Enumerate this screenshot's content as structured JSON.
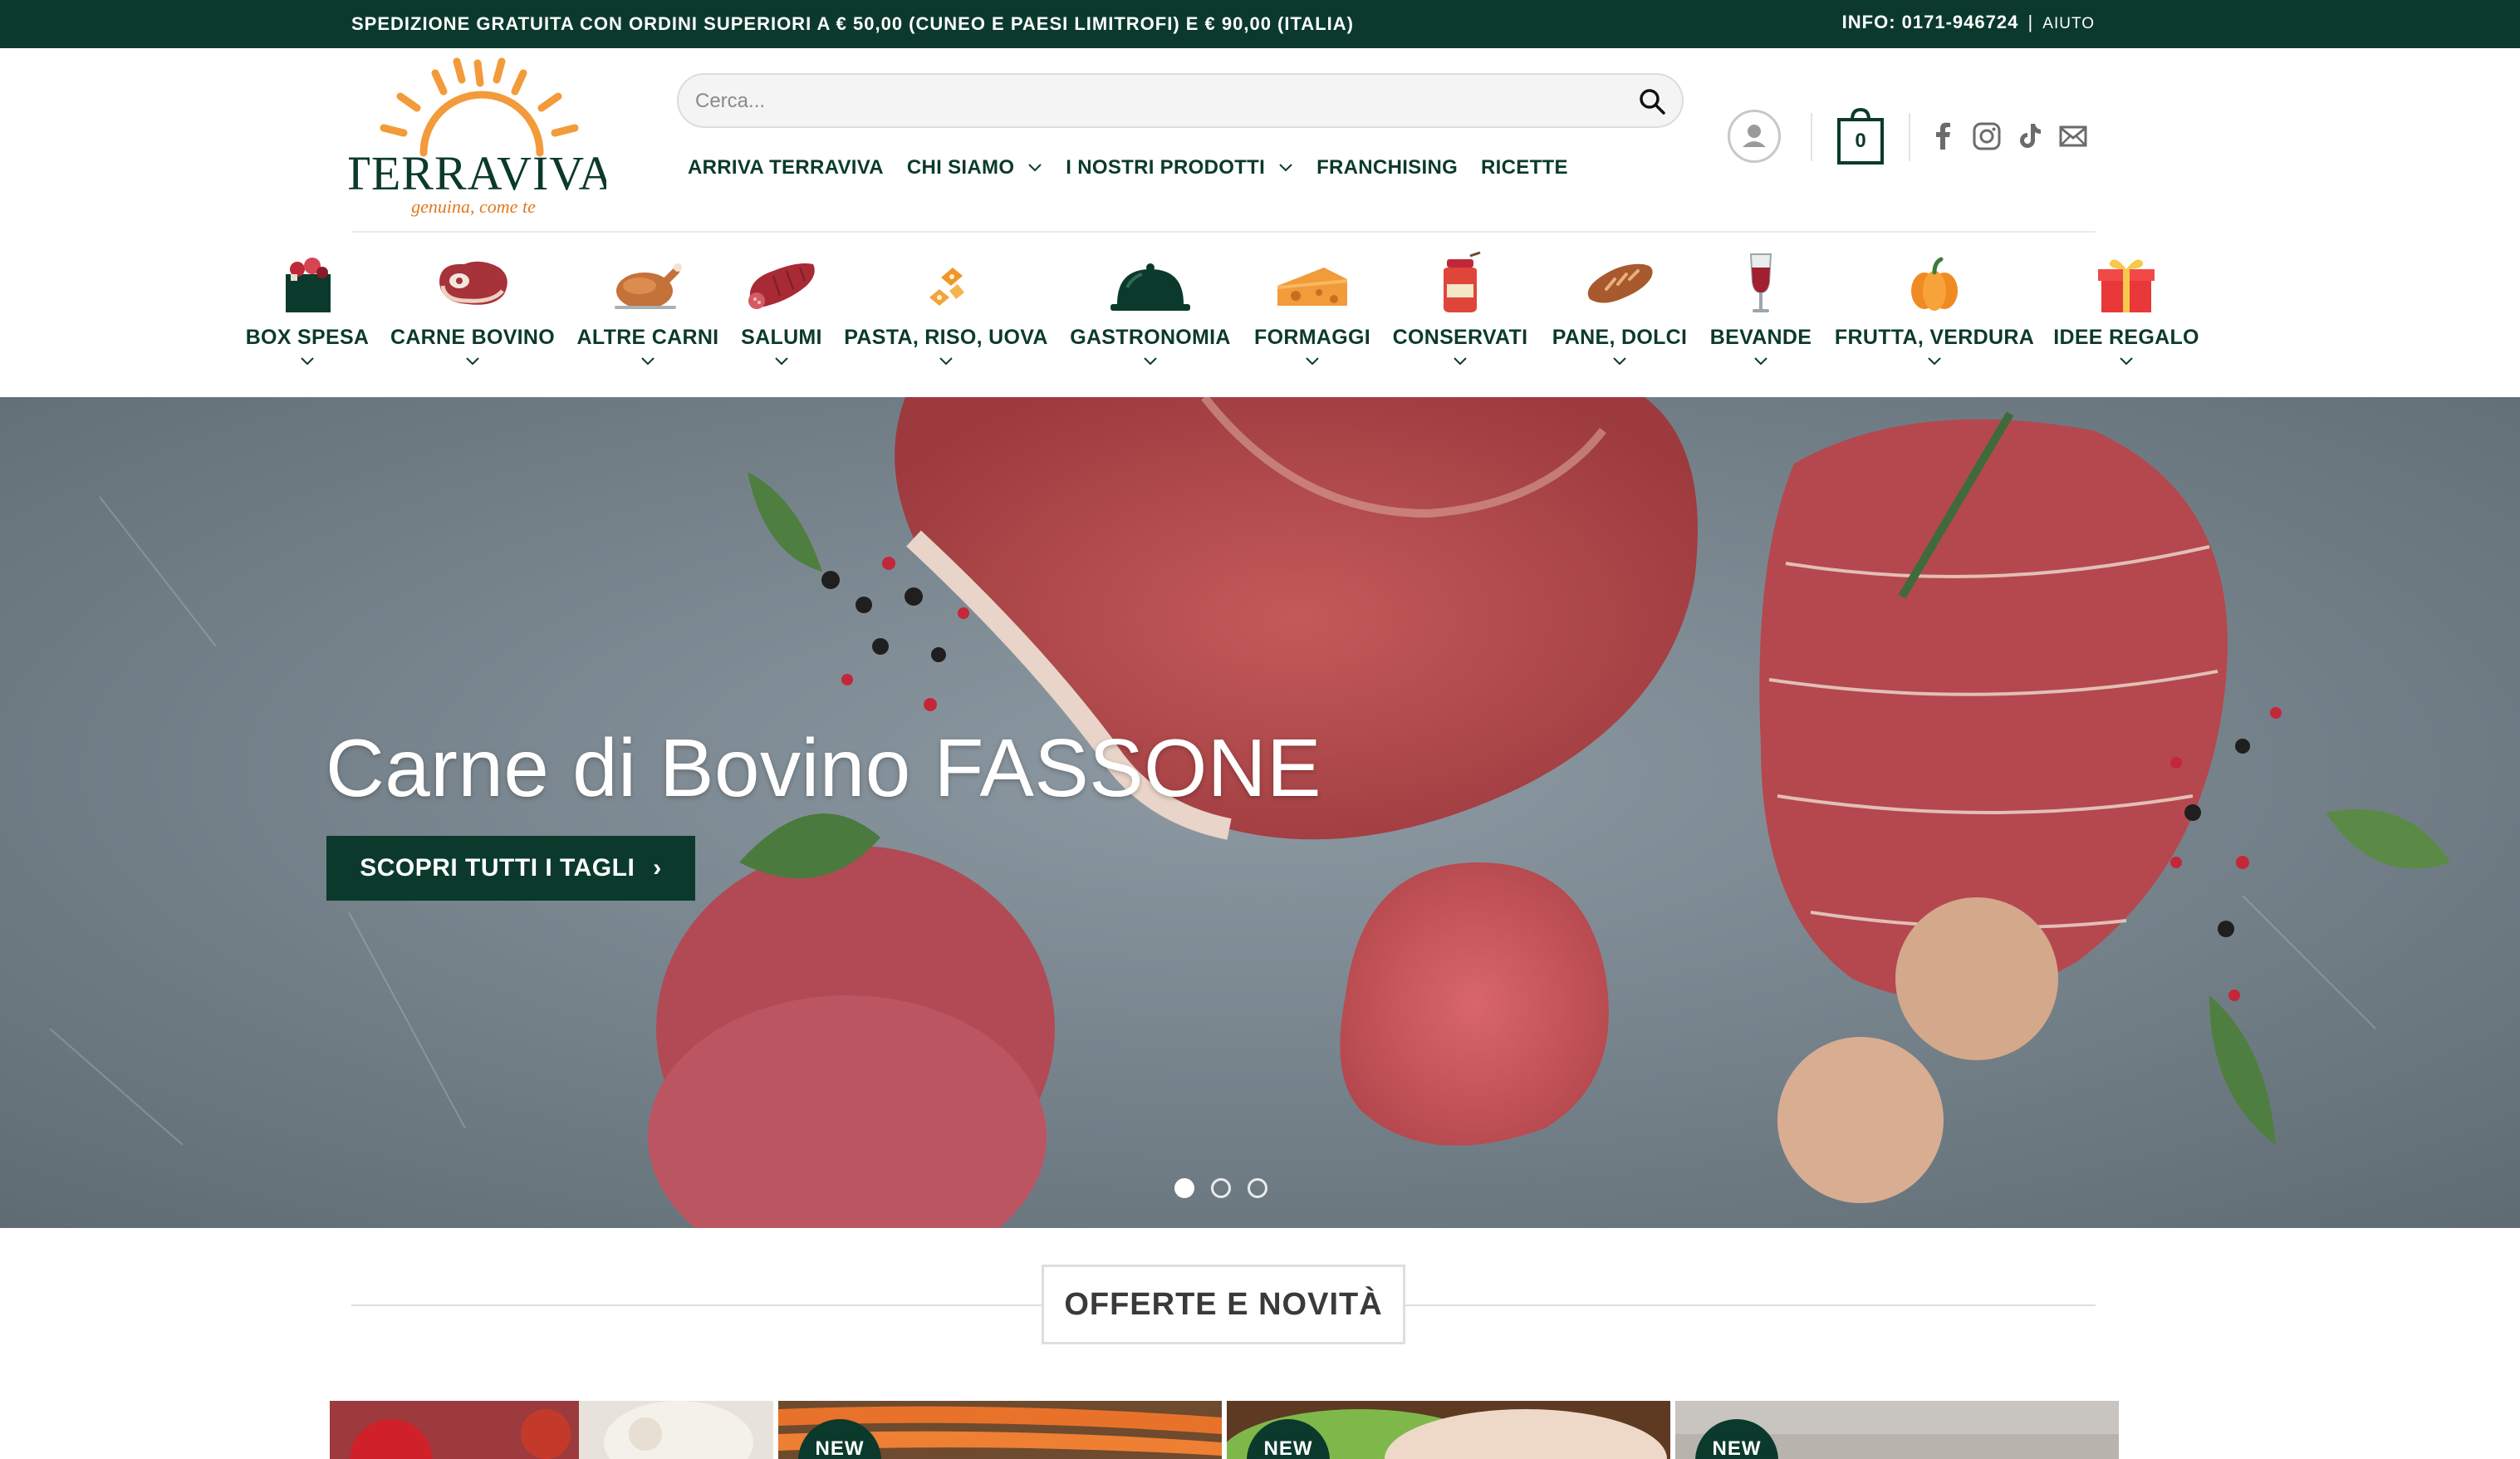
{
  "topbar": {
    "shipping": "SPEDIZIONE GRATUITA CON ORDINI SUPERIORI A € 50,00 (CUNEO E PAESI LIMITROFI) E € 90,00 (ITALIA)",
    "info": "INFO: 0171-946724",
    "separator": "|",
    "help": "AIUTO"
  },
  "logo": {
    "name": "TERRAVIVA",
    "tagline": "genuina, come te",
    "colors": {
      "sun": "#f39a3a",
      "text": "#0b3a2d",
      "tagline": "#e07a1f"
    }
  },
  "search": {
    "placeholder": "Cerca..."
  },
  "nav": [
    {
      "label": "ARRIVA TERRAVIVA",
      "dropdown": false
    },
    {
      "label": "CHI SIAMO",
      "dropdown": true
    },
    {
      "label": "I NOSTRI PRODOTTI",
      "dropdown": true
    },
    {
      "label": "FRANCHISING",
      "dropdown": false
    },
    {
      "label": "RICETTE",
      "dropdown": false
    }
  ],
  "cart": {
    "count": "0"
  },
  "social": [
    "facebook-icon",
    "instagram-icon",
    "tiktok-icon",
    "email-icon"
  ],
  "categories": [
    {
      "label": "BOX SPESA",
      "icon": "grocery-box-icon"
    },
    {
      "label": "CARNE BOVINO",
      "icon": "steak-icon"
    },
    {
      "label": "ALTRE CARNI",
      "icon": "roast-chicken-icon"
    },
    {
      "label": "SALUMI",
      "icon": "salami-icon"
    },
    {
      "label": "PASTA, RISO, UOVA",
      "icon": "pasta-icon"
    },
    {
      "label": "GASTRONOMIA",
      "icon": "cloche-icon"
    },
    {
      "label": "FORMAGGI",
      "icon": "cheese-icon"
    },
    {
      "label": "CONSERVATI",
      "icon": "jar-icon"
    },
    {
      "label": "PANE, DOLCI",
      "icon": "bread-icon"
    },
    {
      "label": "BEVANDE",
      "icon": "wine-glass-icon"
    },
    {
      "label": "FRUTTA, VERDURA",
      "icon": "pumpkin-icon"
    },
    {
      "label": "IDEE REGALO",
      "icon": "gift-icon"
    }
  ],
  "hero": {
    "title": "Carne di Bovino FASSONE",
    "cta": "SCOPRI TUTTI I TAGLI",
    "slides": 3,
    "active_slide": 1
  },
  "section": {
    "title": "OFFERTE E NOVITÀ"
  },
  "products": [
    {
      "badge": "",
      "badge_color": "#d0202a"
    },
    {
      "badge": "NEW",
      "badge_color": "#0b3a2d"
    },
    {
      "badge": "NEW",
      "badge_color": "#0b3a2d"
    },
    {
      "badge": "NEW",
      "badge_color": "#0b3a2d"
    }
  ],
  "colors": {
    "brand_dark": "#0b3a2d",
    "accent": "#f39a3a",
    "sale": "#d0202a"
  }
}
